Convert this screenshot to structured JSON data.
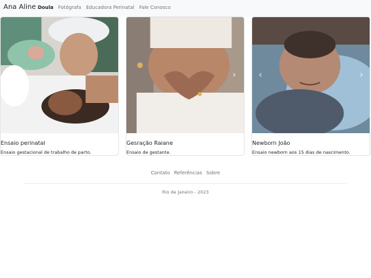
{
  "navbar": {
    "brand": "Ana Aline",
    "links": [
      {
        "label": "Doula",
        "active": true
      },
      {
        "label": "Fotógrafa",
        "active": false
      },
      {
        "label": "Educadora Perinatal",
        "active": false
      },
      {
        "label": "Fale Conosco",
        "active": false
      }
    ]
  },
  "cards": [
    {
      "title": "Ensaio perinatal",
      "text": "Ensaio gestacional de trabalho de parto."
    },
    {
      "title": "Gesração Raiane",
      "text": "Ensaio de gestante."
    },
    {
      "title": "Newborn João",
      "text": "Ensaio newborn aos 15 dias de nascimento."
    }
  ],
  "carousel": {
    "prev": "‹",
    "next": "›"
  },
  "footer": {
    "links": [
      "Contato",
      "Referências",
      "Sobre"
    ],
    "copyright": "Rio de Janeiro - 2023"
  }
}
